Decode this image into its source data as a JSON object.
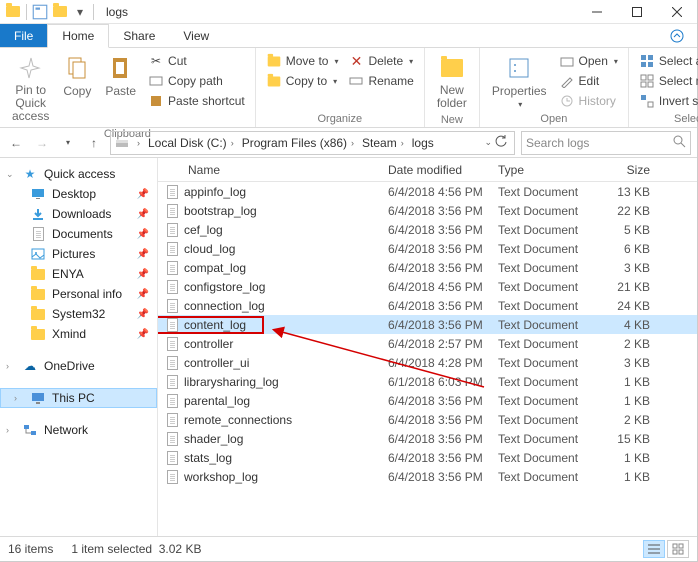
{
  "window": {
    "title": "logs"
  },
  "tabs": {
    "file": "File",
    "home": "Home",
    "share": "Share",
    "view": "View"
  },
  "ribbon": {
    "clipboard": {
      "pin": "Pin to Quick\naccess",
      "copy": "Copy",
      "paste": "Paste",
      "cut": "Cut",
      "copy_path": "Copy path",
      "paste_shortcut": "Paste shortcut",
      "label": "Clipboard"
    },
    "organize": {
      "move_to": "Move to",
      "copy_to": "Copy to",
      "delete": "Delete",
      "rename": "Rename",
      "label": "Organize"
    },
    "new": {
      "new_folder": "New\nfolder",
      "label": "New"
    },
    "open": {
      "properties": "Properties",
      "open": "Open",
      "edit": "Edit",
      "history": "History",
      "label": "Open"
    },
    "select": {
      "select_all": "Select all",
      "select_none": "Select none",
      "invert": "Invert selection",
      "label": "Select"
    }
  },
  "breadcrumb": {
    "segments": [
      "Local Disk (C:)",
      "Program Files (x86)",
      "Steam",
      "logs"
    ]
  },
  "search": {
    "placeholder": "Search logs"
  },
  "sidebar": {
    "quick_access": "Quick access",
    "items": [
      {
        "label": "Desktop",
        "pinned": true
      },
      {
        "label": "Downloads",
        "pinned": true
      },
      {
        "label": "Documents",
        "pinned": true
      },
      {
        "label": "Pictures",
        "pinned": true
      },
      {
        "label": "ENYA",
        "pinned": true
      },
      {
        "label": "Personal info",
        "pinned": true
      },
      {
        "label": "System32",
        "pinned": true
      },
      {
        "label": "Xmind",
        "pinned": true
      }
    ],
    "onedrive": "OneDrive",
    "this_pc": "This PC",
    "network": "Network"
  },
  "columns": {
    "name": "Name",
    "date": "Date modified",
    "type": "Type",
    "size": "Size"
  },
  "files": [
    {
      "name": "appinfo_log",
      "date": "6/4/2018 4:56 PM",
      "type": "Text Document",
      "size": "13 KB"
    },
    {
      "name": "bootstrap_log",
      "date": "6/4/2018 3:56 PM",
      "type": "Text Document",
      "size": "22 KB"
    },
    {
      "name": "cef_log",
      "date": "6/4/2018 3:56 PM",
      "type": "Text Document",
      "size": "5 KB"
    },
    {
      "name": "cloud_log",
      "date": "6/4/2018 3:56 PM",
      "type": "Text Document",
      "size": "6 KB"
    },
    {
      "name": "compat_log",
      "date": "6/4/2018 3:56 PM",
      "type": "Text Document",
      "size": "3 KB"
    },
    {
      "name": "configstore_log",
      "date": "6/4/2018 4:56 PM",
      "type": "Text Document",
      "size": "21 KB"
    },
    {
      "name": "connection_log",
      "date": "6/4/2018 3:56 PM",
      "type": "Text Document",
      "size": "24 KB"
    },
    {
      "name": "content_log",
      "date": "6/4/2018 3:56 PM",
      "type": "Text Document",
      "size": "4 KB",
      "selected": true
    },
    {
      "name": "controller",
      "date": "6/4/2018 2:57 PM",
      "type": "Text Document",
      "size": "2 KB"
    },
    {
      "name": "controller_ui",
      "date": "6/4/2018 4:28 PM",
      "type": "Text Document",
      "size": "3 KB"
    },
    {
      "name": "librarysharing_log",
      "date": "6/1/2018 6:03 PM",
      "type": "Text Document",
      "size": "1 KB"
    },
    {
      "name": "parental_log",
      "date": "6/4/2018 3:56 PM",
      "type": "Text Document",
      "size": "1 KB"
    },
    {
      "name": "remote_connections",
      "date": "6/4/2018 3:56 PM",
      "type": "Text Document",
      "size": "2 KB"
    },
    {
      "name": "shader_log",
      "date": "6/4/2018 3:56 PM",
      "type": "Text Document",
      "size": "15 KB"
    },
    {
      "name": "stats_log",
      "date": "6/4/2018 3:56 PM",
      "type": "Text Document",
      "size": "1 KB"
    },
    {
      "name": "workshop_log",
      "date": "6/4/2018 3:56 PM",
      "type": "Text Document",
      "size": "1 KB"
    }
  ],
  "status": {
    "count": "16 items",
    "selection": "1 item selected",
    "size": "3.02 KB"
  }
}
